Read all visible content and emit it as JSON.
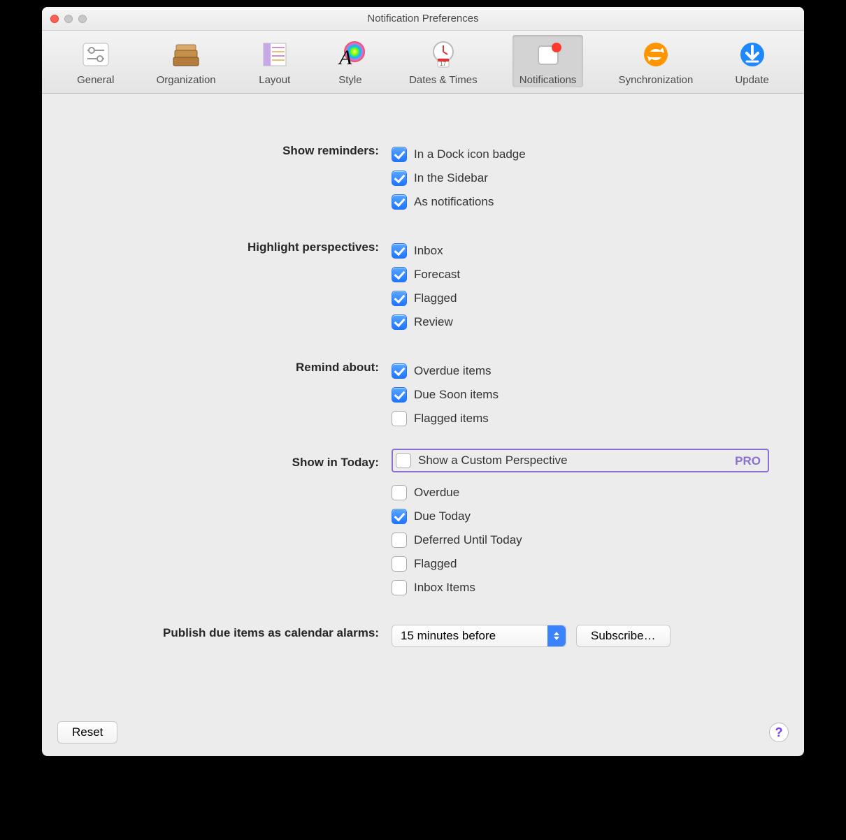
{
  "window": {
    "title": "Notification Preferences"
  },
  "toolbar": {
    "items": [
      {
        "label": "General"
      },
      {
        "label": "Organization"
      },
      {
        "label": "Layout"
      },
      {
        "label": "Style"
      },
      {
        "label": "Dates & Times"
      },
      {
        "label": "Notifications"
      },
      {
        "label": "Synchronization"
      },
      {
        "label": "Update"
      }
    ],
    "active_index": 5
  },
  "sections": {
    "show_reminders": {
      "label": "Show reminders:",
      "options": [
        {
          "label": "In a Dock icon badge",
          "checked": true
        },
        {
          "label": "In the Sidebar",
          "checked": true
        },
        {
          "label": "As notifications",
          "checked": true
        }
      ]
    },
    "highlight_perspectives": {
      "label": "Highlight perspectives:",
      "options": [
        {
          "label": "Inbox",
          "checked": true
        },
        {
          "label": "Forecast",
          "checked": true
        },
        {
          "label": "Flagged",
          "checked": true
        },
        {
          "label": "Review",
          "checked": true
        }
      ]
    },
    "remind_about": {
      "label": "Remind about:",
      "options": [
        {
          "label": "Overdue items",
          "checked": true
        },
        {
          "label": "Due Soon items",
          "checked": true
        },
        {
          "label": "Flagged items",
          "checked": false
        }
      ]
    },
    "show_in_today": {
      "label": "Show in Today:",
      "pro_badge": "PRO",
      "custom": {
        "label": "Show a Custom Perspective",
        "checked": false
      },
      "options": [
        {
          "label": "Overdue",
          "checked": false
        },
        {
          "label": "Due Today",
          "checked": true
        },
        {
          "label": "Deferred Until Today",
          "checked": false
        },
        {
          "label": "Flagged",
          "checked": false
        },
        {
          "label": "Inbox Items",
          "checked": false
        }
      ]
    },
    "publish": {
      "label": "Publish due items as calendar alarms:",
      "select_value": "15 minutes before",
      "subscribe_label": "Subscribe…"
    }
  },
  "footer": {
    "reset_label": "Reset",
    "help_label": "?"
  }
}
